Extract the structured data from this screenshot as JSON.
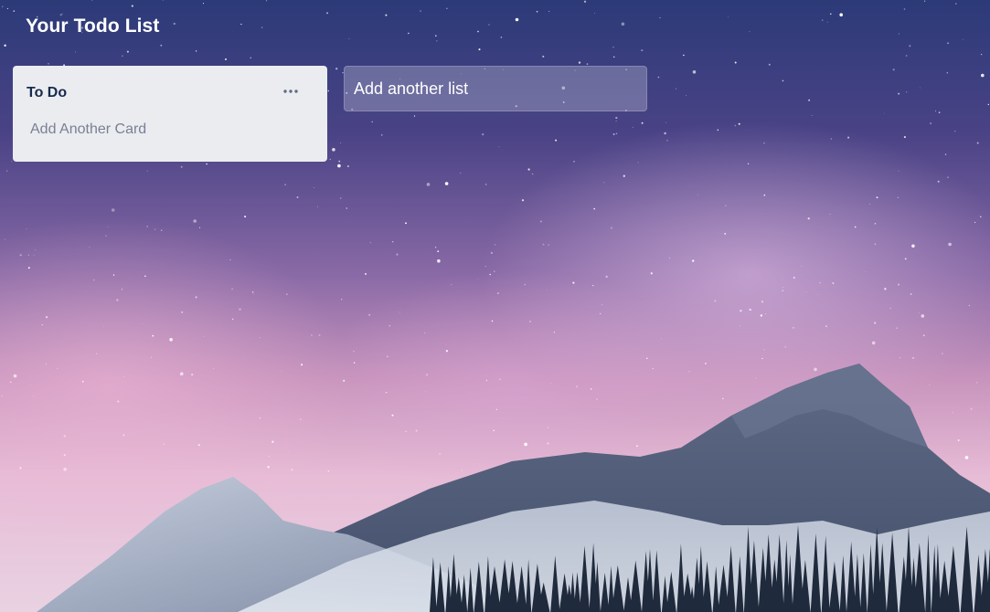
{
  "board": {
    "title": "Your Todo List"
  },
  "lists": [
    {
      "title": "To Do",
      "menu_icon": "more-horizontal-icon",
      "add_card_label": "Add Another Card"
    }
  ],
  "add_list": {
    "placeholder": "Add another list"
  },
  "background": {
    "scene": "mountain-milky-way",
    "colors": {
      "sky_top": "#2c3a78",
      "sky_mid": "#8a6aa6",
      "sky_glow": "#e7bcd6",
      "mountain_dark": "#3b4a66",
      "mountain_snow": "#d8dfea"
    }
  }
}
